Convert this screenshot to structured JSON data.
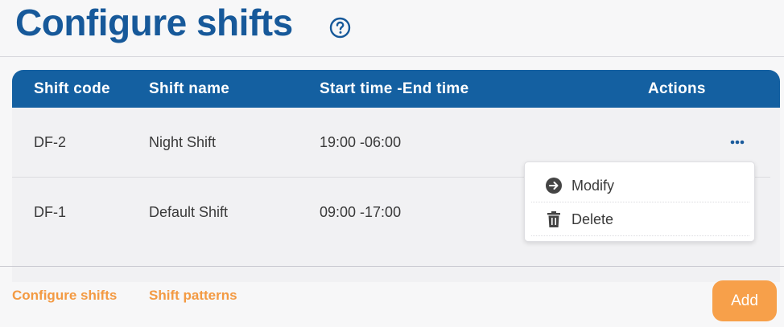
{
  "header": {
    "title": "Configure shifts",
    "help_icon": "help-circle-icon"
  },
  "table": {
    "columns": [
      "Shift code",
      "Shift name",
      "Start time -End time",
      "Actions"
    ],
    "rows": [
      {
        "code": "DF-2",
        "name": "Night Shift",
        "time": "19:00 -06:00"
      },
      {
        "code": "DF-1",
        "name": "Default Shift",
        "time": "09:00 -17:00"
      }
    ],
    "row_action_icon": "more-horizontal-icon"
  },
  "action_menu": {
    "items": [
      {
        "label": "Modify",
        "icon": "arrow-right-circle-icon"
      },
      {
        "label": "Delete",
        "icon": "trash-icon"
      }
    ]
  },
  "footer": {
    "tabs": [
      {
        "label": "Configure shifts"
      },
      {
        "label": "Shift patterns"
      }
    ],
    "add_label": "Add"
  },
  "colors": {
    "title": "#17599a",
    "table_header": "#1460a1",
    "accent": "#f7a04a",
    "link": "#f39a43"
  }
}
